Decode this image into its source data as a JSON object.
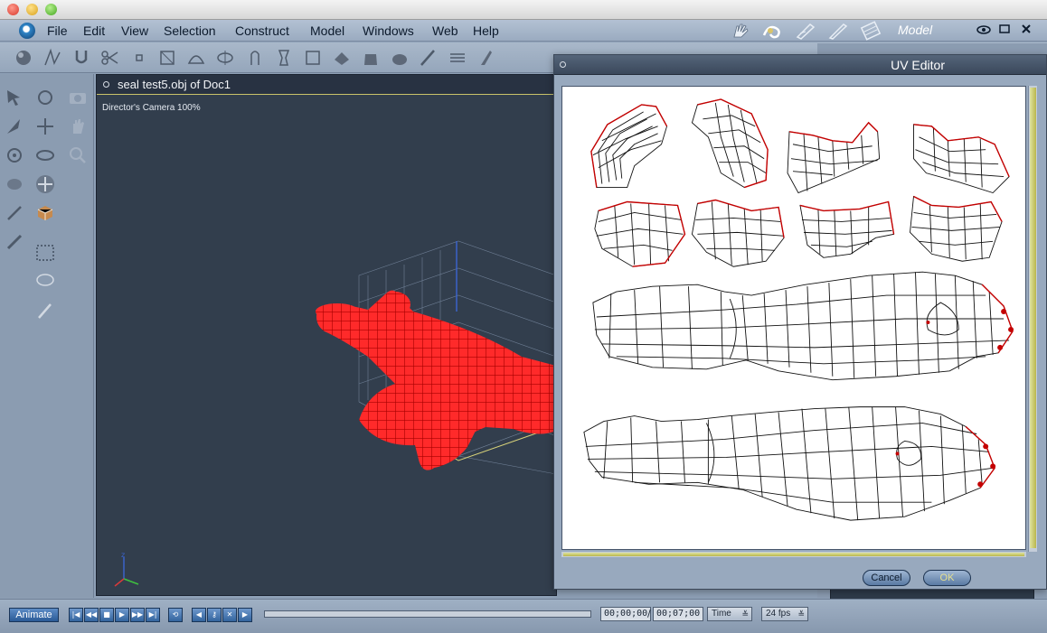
{
  "menu": {
    "items": [
      "File",
      "Edit",
      "View",
      "Selection",
      "Construct",
      "Model",
      "Windows",
      "Web",
      "Help"
    ],
    "room_label": "Model"
  },
  "document": {
    "title": "seal test5.obj of Doc1",
    "camera_label": "Director's Camera 100%"
  },
  "uv_editor": {
    "title": "UV Editor",
    "cancel_label": "Cancel",
    "ok_label": "OK"
  },
  "bottom": {
    "animate_label": "Animate",
    "current_time": "00;00;00",
    "end_time": "00;07;00",
    "time_mode": "Time",
    "fps": "24 fps"
  },
  "colors": {
    "mesh_red": "#ff1a1a",
    "uv_wire": "#111111",
    "uv_vertex": "#c40000",
    "viewport_bg": "#323e4d"
  },
  "icons": {
    "toolbar": [
      "sphere-icon",
      "curve-icon",
      "magnet-icon",
      "scissors-icon",
      "point-icon",
      "bevel-icon",
      "dome-icon",
      "lathe-icon",
      "extrude-icon",
      "vase-icon",
      "box-icon",
      "eraser-icon",
      "bag-icon",
      "sculpt-icon",
      "brush-icon",
      "align-icon",
      "knife-icon"
    ],
    "palette": [
      "arrow-icon",
      "rotate-icon",
      "camera-icon",
      "direct-icon",
      "move-icon",
      "hand-icon",
      "orbit-icon",
      "scale-icon",
      "zoom-icon",
      "twist-icon",
      "move-xyz-icon",
      "wand-icon",
      "box-3d-icon",
      "link-icon",
      "rect-select-icon",
      "lasso-icon",
      "paint-select-icon"
    ]
  }
}
